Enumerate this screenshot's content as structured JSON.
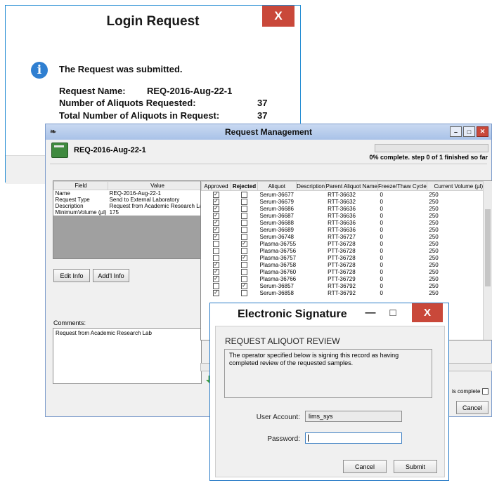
{
  "login_dialog": {
    "title": "Login Request",
    "close_label": "X",
    "message": "The Request was submitted.",
    "rows": [
      {
        "label": "Request Name:",
        "value": "REQ-2016-Aug-22-1"
      },
      {
        "label": "Number of Aliquots Requested:",
        "value": "37"
      },
      {
        "label": "Total Number of Aliquots in Request:",
        "value": "37"
      }
    ]
  },
  "request_mgmt": {
    "title": "Request Management",
    "request_name": "REQ-2016-Aug-22-1",
    "progress_text": "0% complete. step 0 of 1 finished so far",
    "progress_fraction": 0,
    "field_table": {
      "headers": [
        "Field",
        "Value"
      ],
      "rows": [
        {
          "field": "Name",
          "value": "REQ-2016-Aug-22-1"
        },
        {
          "field": "Request Type",
          "value": "Send to External Laboratory"
        },
        {
          "field": "Description",
          "value": "Request from Academic Research Lab"
        },
        {
          "field": "MinimumVolume (µl)",
          "value": "175"
        }
      ]
    },
    "edit_info_label": "Edit Info",
    "add_info_label": "Add'l Info",
    "comments_label": "Comments:",
    "comments_text": "Request from Academic Research Lab",
    "grid_headers": [
      "Approved",
      "Rejected",
      "Aliquot",
      "Description",
      "Parent Aliquot Name",
      "Freeze/Thaw Cycle",
      "Current Volume (µl)"
    ],
    "grid_rows": [
      {
        "approved": true,
        "rejected": false,
        "aliquot": "Serum-36677",
        "description": "",
        "parent": "RTT-36632",
        "freeze": "0",
        "volume": "250"
      },
      {
        "approved": true,
        "rejected": false,
        "aliquot": "Serum-36679",
        "description": "",
        "parent": "RTT-36632",
        "freeze": "0",
        "volume": "250"
      },
      {
        "approved": true,
        "rejected": false,
        "aliquot": "Serum-36686",
        "description": "",
        "parent": "RTT-36636",
        "freeze": "0",
        "volume": "250"
      },
      {
        "approved": true,
        "rejected": false,
        "aliquot": "Serum-36687",
        "description": "",
        "parent": "RTT-36636",
        "freeze": "0",
        "volume": "250"
      },
      {
        "approved": true,
        "rejected": false,
        "aliquot": "Serum-36688",
        "description": "",
        "parent": "RTT-36636",
        "freeze": "0",
        "volume": "250"
      },
      {
        "approved": true,
        "rejected": false,
        "aliquot": "Serum-36689",
        "description": "",
        "parent": "RTT-36636",
        "freeze": "0",
        "volume": "250"
      },
      {
        "approved": true,
        "rejected": false,
        "aliquot": "Serum-36748",
        "description": "",
        "parent": "RTT-36727",
        "freeze": "0",
        "volume": "250"
      },
      {
        "approved": false,
        "rejected": true,
        "aliquot": "Plasma-36755",
        "description": "",
        "parent": "PTT-36728",
        "freeze": "0",
        "volume": "250"
      },
      {
        "approved": false,
        "rejected": false,
        "aliquot": "Plasma-36756",
        "description": "",
        "parent": "PTT-36728",
        "freeze": "0",
        "volume": "250"
      },
      {
        "approved": false,
        "rejected": true,
        "aliquot": "Plasma-36757",
        "description": "",
        "parent": "PTT-36728",
        "freeze": "0",
        "volume": "250"
      },
      {
        "approved": true,
        "rejected": false,
        "aliquot": "Plasma-36758",
        "description": "",
        "parent": "PTT-36728",
        "freeze": "0",
        "volume": "250"
      },
      {
        "approved": true,
        "rejected": false,
        "aliquot": "Plasma-36760",
        "description": "",
        "parent": "PTT-36728",
        "freeze": "0",
        "volume": "250"
      },
      {
        "approved": true,
        "rejected": false,
        "aliquot": "Plasma-36766",
        "description": "",
        "parent": "PTT-36729",
        "freeze": "0",
        "volume": "250"
      },
      {
        "approved": false,
        "rejected": true,
        "aliquot": "Serum-36857",
        "description": "",
        "parent": "RTT-36792",
        "freeze": "0",
        "volume": "250"
      },
      {
        "approved": true,
        "rejected": false,
        "aliquot": "Serum-36858",
        "description": "",
        "parent": "RTT-36792",
        "freeze": "0",
        "volume": "250"
      }
    ],
    "complete_label": "is complete",
    "cancel_label": "Cancel"
  },
  "esig": {
    "title": "Electronic Signature",
    "minimize_label": "—",
    "maximize_label": "□",
    "close_label": "X",
    "heading": "REQUEST ALIQUOT REVIEW",
    "statement": "The operator specified below is signing this record as having completed review of the requested samples.",
    "user_account_label": "User Account:",
    "user_account_value": "lims_sys",
    "password_label": "Password:",
    "password_value": "",
    "cancel_label": "Cancel",
    "submit_label": "Submit"
  }
}
